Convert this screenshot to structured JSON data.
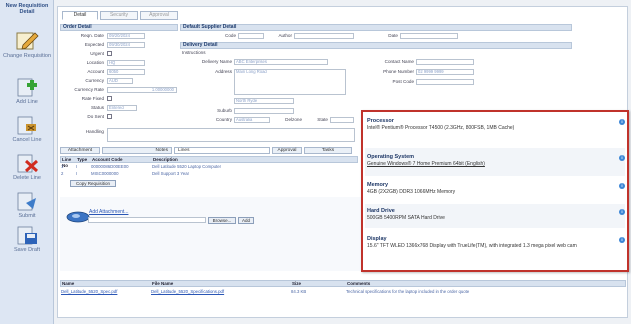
{
  "sidebar": {
    "header": "New Requisition Detail",
    "items": [
      {
        "label": "Change Requisition",
        "icon": "edit-pencil-icon"
      },
      {
        "label": "Add Line",
        "icon": "add-line-icon"
      },
      {
        "label": "Cancel Line",
        "icon": "cancel-line-icon"
      },
      {
        "label": "Delete Line",
        "icon": "delete-line-icon"
      },
      {
        "label": "Submit",
        "icon": "submit-icon"
      },
      {
        "label": "Save Draft",
        "icon": "save-draft-icon"
      }
    ]
  },
  "tabs": [
    "Detail",
    "Security",
    "Approval"
  ],
  "order_section": {
    "title": "Order Detail",
    "fields": [
      {
        "label": "Reqn. Date",
        "value": "09/20/2024"
      },
      {
        "label": "Expected",
        "value": "09/30/2024"
      },
      {
        "label": "Urgent",
        "value": ""
      },
      {
        "label": "Location",
        "value": "HQ"
      },
      {
        "label": "Account",
        "value": "6050"
      },
      {
        "label": "Currency",
        "value": "AUD"
      },
      {
        "label": "Currency Rate",
        "value": "1.00000000"
      },
      {
        "label": "Rate Fixed",
        "value": ""
      },
      {
        "label": "Status",
        "value": "Entered"
      },
      {
        "label": "Do Sent",
        "value": ""
      }
    ]
  },
  "supplier_section": {
    "title": "Default Supplier Detail",
    "code_label": "Code",
    "author_label": "Author",
    "date_label": "Date"
  },
  "delivery_section": {
    "title": "Delivery Detail",
    "sub_title": "Instructions",
    "name_label": "Delivery Name",
    "name_value": "ABC Enterprises",
    "address_label": "Address",
    "address_value": "Main Long Road",
    "contact_label": "Contact Name",
    "phone_label": "Phone Number",
    "phone_value": "02 9999 9999",
    "suburb_label": "Suburb",
    "postcode_label": "Post Code",
    "state_label": "State",
    "country_label": "Country",
    "country_value": "Australia",
    "zone_label": "Delzone",
    "city_value": "North Ryde"
  },
  "handling_label": "Handling",
  "bottom_tabs": [
    "Attachment",
    "Notes",
    "Lines",
    "Approval",
    "Tasks"
  ],
  "lines_table": {
    "headers": [
      "Line No",
      "Type",
      "Account Code",
      "Description"
    ],
    "rows": [
      {
        "line": "1",
        "type": "I",
        "code": "00000086D00EE00",
        "desc": "Dell Latitude 5520 Laptop Computer"
      },
      {
        "line": "2",
        "type": "I",
        "code": "MISC0000000",
        "desc": "Dell Support 3 Year"
      }
    ]
  },
  "copy_requisition_label": "Copy Requisition",
  "attachment": {
    "label": "Add Attachment...",
    "browse_label": "Browse...",
    "add_label": "Add",
    "headers": [
      "Name",
      "File Name",
      "Size",
      "Comments"
    ],
    "row": {
      "name": "Dell_Latitude_5520_Spec.pdf",
      "file": "Dell_Latitude_5520_Specifications.pdf",
      "size": "84.3 KB",
      "comment": "Technical specifications for the laptop included in the order quote"
    }
  },
  "popup": {
    "specs": [
      {
        "title": "Processor",
        "value": "Intel® Pentium® Processor T4500 (2.3GHz, 800FSB, 1MB Cache)"
      },
      {
        "title": "Operating System",
        "value": "Genuine Windows® 7 Home Premium 64bit (English)"
      },
      {
        "title": "Memory",
        "value": "4GB (2X2GB) DDR3 1066MHz Memory"
      },
      {
        "title": "Hard Drive",
        "value": "500GB 5400RPM SATA Hard Drive"
      },
      {
        "title": "Display",
        "value": "15.6\" TFT WLED 1366x768 Display with TrueLife(TM), with integrated 1.3 mega pixel web cam"
      }
    ],
    "info_glyph": "i"
  }
}
